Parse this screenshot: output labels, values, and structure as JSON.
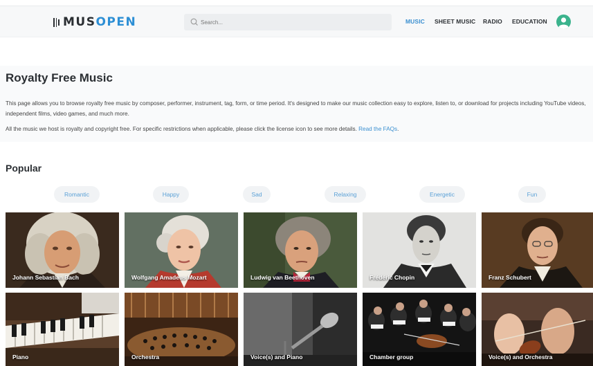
{
  "header": {
    "logo_left": "MUS",
    "logo_right": "OPEN",
    "search_placeholder": "Search...",
    "nav": [
      {
        "label": "MUSIC",
        "active": true
      },
      {
        "label": "SHEET MUSIC",
        "active": false
      },
      {
        "label": "RADIO",
        "active": false
      },
      {
        "label": "EDUCATION",
        "active": false
      }
    ]
  },
  "page": {
    "title": "Royalty Free Music",
    "para1": "This page allows you to browse royalty free music by composer, performer, instrument, tag, form, or time period. It's designed to make our music collection easy to explore, listen to, or download for projects including YouTube videos, independent films, video games, and much more.",
    "para2": "All the music we host is royalty and copyright free. For specific restrictions when applicable, please click the license icon to see more details.",
    "faq_link": "Read the FAQs",
    "para2_end": "."
  },
  "popular": {
    "title": "Popular",
    "tags": [
      "Romantic",
      "Happy",
      "Sad",
      "Relaxing",
      "Energetic",
      "Fun"
    ]
  },
  "composers": [
    {
      "name": "Johann Sebastian Bach",
      "icon": "portrait-bach"
    },
    {
      "name": "Wolfgang Amadeus Mozart",
      "icon": "portrait-mozart"
    },
    {
      "name": "Ludwig van Beethoven",
      "icon": "portrait-beethoven"
    },
    {
      "name": "Frédéric Chopin",
      "icon": "portrait-chopin"
    },
    {
      "name": "Franz Schubert",
      "icon": "portrait-schubert"
    }
  ],
  "instruments": [
    {
      "name": "Piano",
      "icon": "piano-photo"
    },
    {
      "name": "Orchestra",
      "icon": "orchestra-photo"
    },
    {
      "name": "Voice(s) and Piano",
      "icon": "microphone-photo"
    },
    {
      "name": "Chamber group",
      "icon": "chamber-group-photo"
    },
    {
      "name": "Voice(s) and Orchestra",
      "icon": "violin-orchestra-photo"
    }
  ],
  "colors": {
    "accent": "#3a8fd0",
    "logo_dark": "#2b2f33",
    "avatar": "#3bb38d"
  }
}
